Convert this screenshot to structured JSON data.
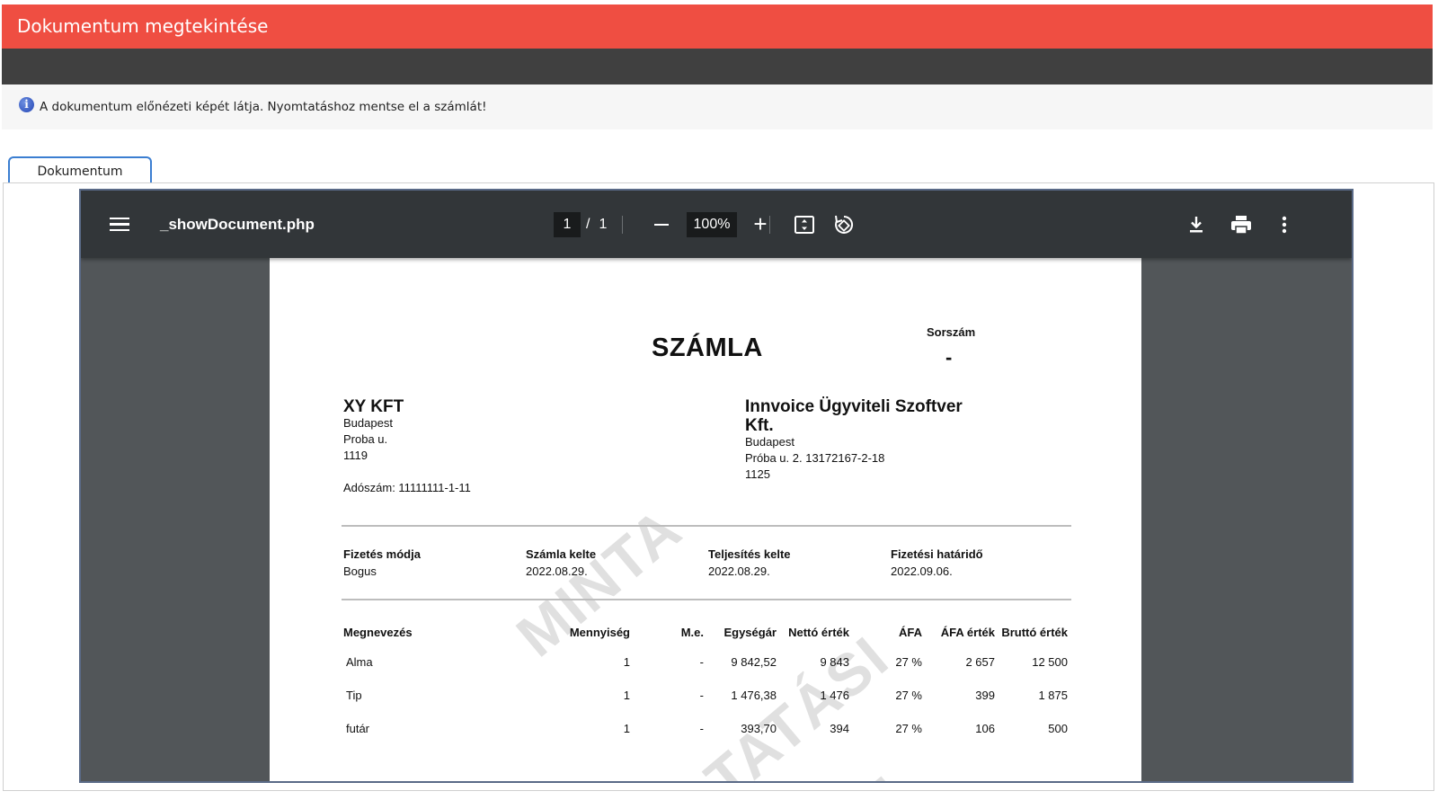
{
  "window": {
    "title": "Dokumentum megtekintése"
  },
  "notice": {
    "icon": "info-icon",
    "text": "A dokumentum előnézeti képét látja. Nyomtatáshoz mentse el a számlát!"
  },
  "tabs": [
    {
      "label": "Dokumentum",
      "active": true
    }
  ],
  "viewer": {
    "file_name": "_showDocument.php",
    "page_current": "1",
    "page_separator": "/",
    "page_total": "1",
    "zoom": "100%",
    "icons": [
      "menu-icon",
      "zoom-out-icon",
      "zoom-in-icon",
      "fit-page-icon",
      "rotate-icon",
      "download-icon",
      "print-icon",
      "more-options-icon"
    ]
  },
  "invoice": {
    "title": "SZÁMLA",
    "serial_label": "Sorszám",
    "serial_value": "-",
    "buyer": {
      "name": "XY KFT",
      "city": "Budapest",
      "street": "Proba u.",
      "zip": "1119",
      "tax_id": "Adószám: 11111111-1-11"
    },
    "seller": {
      "name_line1": "Innvoice Ügyviteli Szoftver",
      "name_line2": "Kft.",
      "city": "Budapest",
      "street": "Próba u. 2. 13172167-2-18",
      "zip": "1125"
    },
    "meta": [
      {
        "label": "Fizetés módja",
        "value": "Bogus"
      },
      {
        "label": "Számla kelte",
        "value": "2022.08.29."
      },
      {
        "label": "Teljesítés kelte",
        "value": "2022.08.29."
      },
      {
        "label": "Fizetési határidő",
        "value": "2022.09.06."
      }
    ],
    "columns": [
      "Megnevezés",
      "Mennyiség",
      "M.e.",
      "Egységár",
      "Nettó érték",
      "ÁFA",
      "ÁFA érték",
      "Bruttó érték"
    ],
    "rows": [
      [
        "Alma",
        "1",
        "-",
        "9 842,52",
        "9 843",
        "27 %",
        "2 657",
        "12 500"
      ],
      [
        "Tip",
        "1",
        "-",
        "1 476,38",
        "1 476",
        "27 %",
        "399",
        "1 875"
      ],
      [
        "futár",
        "1",
        "-",
        "393,70",
        "394",
        "27 %",
        "106",
        "500"
      ]
    ],
    "watermark": [
      "MINTA",
      "TATÁSI",
      "T"
    ]
  },
  "colors": {
    "title_bar": "#ef4e42",
    "sub_bar": "#404040",
    "tab_border": "#3b7ed1",
    "viewer_toolbar": "#323639",
    "viewer_bg": "#525659"
  }
}
